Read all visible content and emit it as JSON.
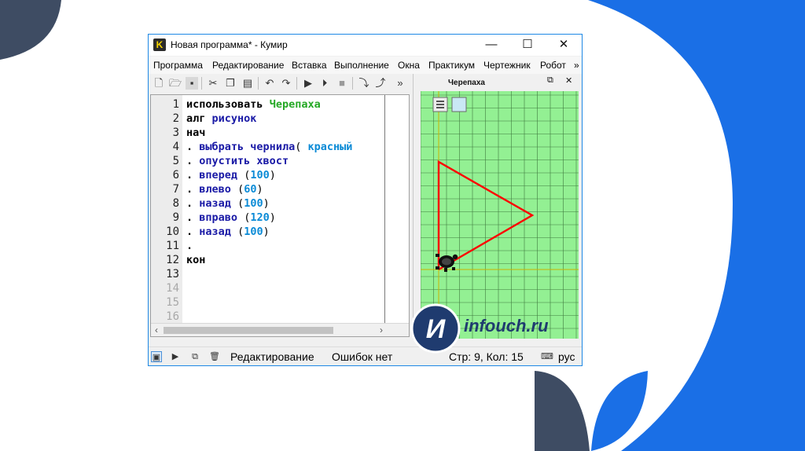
{
  "window": {
    "title": "Новая программа* - Кумир",
    "app_icon_letter": "K"
  },
  "menu": [
    "Программа",
    "Редактирование",
    "Вставка",
    "Выполнение",
    "Окна",
    "Практикум",
    "Чертежник",
    "Робот",
    "»"
  ],
  "toolbar": {
    "icons": [
      "new-file-icon",
      "open-folder-icon",
      "save-icon",
      "cut-icon",
      "copy-icon",
      "paste-icon",
      "undo-icon",
      "redo-icon",
      "run-icon",
      "step-run-icon",
      "stop-icon",
      "step-into-icon",
      "step-out-icon"
    ],
    "overflow": "»"
  },
  "editor": {
    "line_numbers": [
      "1",
      "2",
      "3",
      "4",
      "5",
      "6",
      "7",
      "8",
      "9",
      "10",
      "11",
      "12",
      "13",
      "14",
      "15",
      "16"
    ],
    "lines": [
      {
        "prefix": "",
        "kw": "использовать",
        "fn": "",
        "mod": "Черепаха",
        "open": "",
        "num": "",
        "close": ""
      },
      {
        "prefix": "",
        "kw": "алг",
        "fn": "рисунок",
        "mod": "",
        "open": "",
        "num": "",
        "close": ""
      },
      {
        "prefix": "",
        "kw": "нач",
        "fn": "",
        "mod": "",
        "open": "",
        "num": "",
        "close": ""
      },
      {
        "prefix": ".",
        "kw": "",
        "fn": "выбрать чернила",
        "mod": "",
        "open": "(",
        "num": "красный",
        "close": ""
      },
      {
        "prefix": ".",
        "kw": "",
        "fn": "опустить хвост",
        "mod": "",
        "open": "",
        "num": "",
        "close": ""
      },
      {
        "prefix": ".",
        "kw": "",
        "fn": "вперед",
        "mod": "",
        "open": "(",
        "num": "100",
        "close": ")"
      },
      {
        "prefix": ".",
        "kw": "",
        "fn": "влево",
        "mod": "",
        "open": "(",
        "num": "60",
        "close": ")"
      },
      {
        "prefix": ".",
        "kw": "",
        "fn": "назад",
        "mod": "",
        "open": "(",
        "num": "100",
        "close": ")"
      },
      {
        "prefix": ".",
        "kw": "",
        "fn": "вправо",
        "mod": "",
        "open": "(",
        "num": "120",
        "close": ")"
      },
      {
        "prefix": ".",
        "kw": "",
        "fn": "назад",
        "mod": "",
        "open": "(",
        "num": "100",
        "close": ")"
      },
      {
        "prefix": ".",
        "kw": "",
        "fn": "",
        "mod": "",
        "open": "",
        "num": "",
        "close": ""
      },
      {
        "prefix": "",
        "kw": "кон",
        "fn": "",
        "mod": "",
        "open": "",
        "num": "",
        "close": ""
      }
    ],
    "scroll_left": "‹",
    "scroll_right": "›"
  },
  "turtle_panel": {
    "title": "Черепаха",
    "undock_icon": "undock-icon",
    "close_label": "✕",
    "grid_color": "#93f093",
    "line_color": "#ff0000",
    "axis_color": "#c8b400",
    "menu_icon": "menu-icon"
  },
  "status": {
    "icons": [
      "console-icon",
      "output-icon",
      "copy-output-icon",
      "trash-icon"
    ],
    "mode": "Редактирование",
    "errors": "Ошибок нет",
    "position": "Стр: 9, Кол: 15",
    "lang": "рус",
    "keyboard_icon": "keyboard-icon"
  },
  "logo": {
    "letter": "И",
    "text": "infouch.ru"
  }
}
